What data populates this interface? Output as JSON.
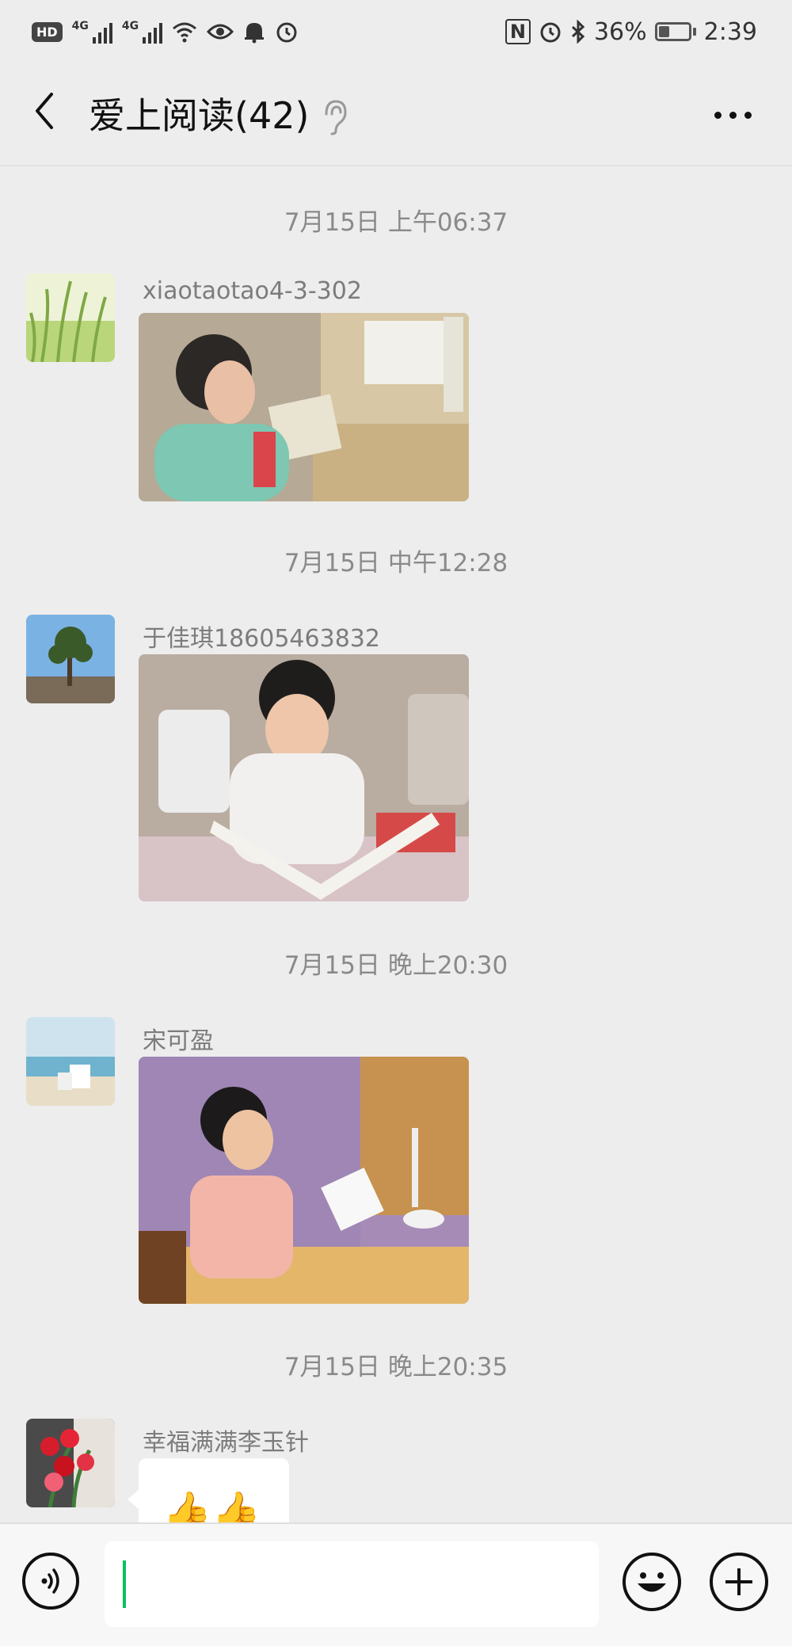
{
  "status_bar": {
    "hd": "HD",
    "net1": "4G",
    "net2": "4G",
    "nfc": "N",
    "battery": "36%",
    "battery_level": 0.36,
    "time": "2:39"
  },
  "header": {
    "title": "爱上阅读(42)",
    "back_icon": "chevron-left-icon",
    "ear_icon": "ear-icon",
    "more_icon": "more-dots-icon"
  },
  "messages": [
    {
      "timestamp": "7月15日 上午06:37",
      "sender": "xiaotaotao4-3-302",
      "type": "image"
    },
    {
      "timestamp": "7月15日 中午12:28",
      "sender": "于佳琪18605463832",
      "type": "image"
    },
    {
      "timestamp": "7月15日 晚上20:30",
      "sender": "宋可盈",
      "type": "image"
    },
    {
      "timestamp": "7月15日 晚上20:35",
      "sender": "幸福满满李玉针",
      "type": "emoji",
      "content": "👍👍"
    }
  ],
  "input_bar": {
    "voice_icon": "voice-icon",
    "input_value": "",
    "emoji_icon": "emoji-icon",
    "plus_icon": "plus-icon"
  },
  "colors": {
    "background": "#ededed",
    "cursor": "#07c160"
  }
}
